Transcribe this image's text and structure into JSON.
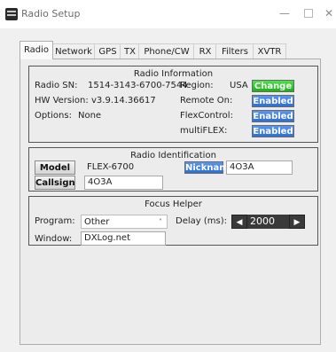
{
  "window": {
    "title": "Radio Setup",
    "minimize_glyph": "—",
    "close_glyph": "✕"
  },
  "tabs": [
    {
      "label": "Radio",
      "active": true
    },
    {
      "label": "Network"
    },
    {
      "label": "GPS"
    },
    {
      "label": "TX"
    },
    {
      "label": "Phone/CW"
    },
    {
      "label": "RX"
    },
    {
      "label": "Filters"
    },
    {
      "label": "XVTR"
    }
  ],
  "radio_info": {
    "title": "Radio Information",
    "sn_label": "Radio SN:",
    "sn_value": "1514-3143-6700-7544",
    "hw_label": "HW Version:",
    "hw_value": "v3.9.14.36617",
    "options_label": "Options:",
    "options_value": "None",
    "region_label": "Region:",
    "region_value": "USA",
    "change_button": "Change",
    "remote_on_label": "Remote On:",
    "remote_on_value": "Enabled",
    "flexcontrol_label": "FlexControl:",
    "flexcontrol_value": "Enabled",
    "multiflex_label": "multiFLEX:",
    "multiflex_value": "Enabled"
  },
  "radio_ident": {
    "title": "Radio Identification",
    "model_button": "Model",
    "model_value": "FLEX-6700",
    "nickname_label": "Nickname",
    "nickname_value": "4O3A",
    "callsign_button": "Callsign",
    "callsign_value": "4O3A"
  },
  "focus_helper": {
    "title": "Focus Helper",
    "program_label": "Program:",
    "program_value": "Other",
    "delay_label": "Delay (ms):",
    "delay_value": "2000",
    "window_label": "Window:",
    "window_value": "DXLog.net"
  },
  "colors": {
    "enabled_blue": "#2d6fd6",
    "change_green": "#19b313",
    "delay_dark": "#3a3a3a"
  }
}
